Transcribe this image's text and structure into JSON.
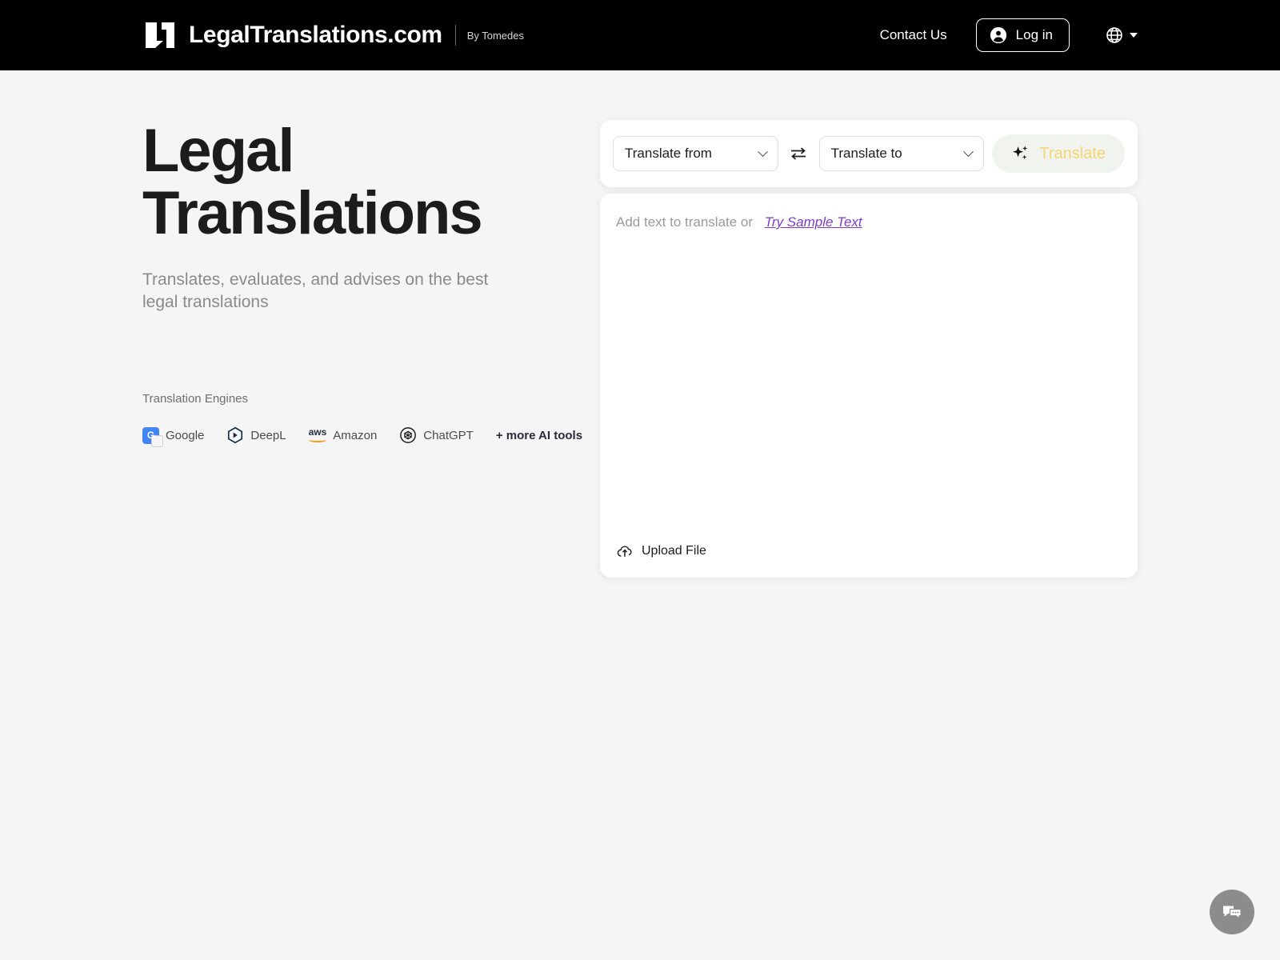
{
  "header": {
    "brand_name": "LegalTranslations.com",
    "brand_by": "By Tomedes",
    "contact_label": "Contact Us",
    "login_label": "Log in",
    "logo_icon": "legal-translations-logo",
    "account_icon": "account-circle-icon",
    "globe_icon": "globe-icon",
    "caret_icon": "chevron-down-icon",
    "background": "#000000"
  },
  "hero": {
    "headline_line1": "Legal",
    "headline_line2": "Translations",
    "subtitle": "Translates, evaluates, and advises on the best legal translations",
    "engines_label": "Translation Engines",
    "engines": [
      {
        "name": "Google",
        "icon": "google-translate-icon",
        "glyph": "G"
      },
      {
        "name": "DeepL",
        "icon": "deepl-icon"
      },
      {
        "name": "Amazon",
        "icon": "aws-icon",
        "glyph": "aws"
      },
      {
        "name": "ChatGPT",
        "icon": "openai-icon"
      }
    ],
    "more_tools_label": "+ more AI tools"
  },
  "translator": {
    "source_select": {
      "value": "Translate from",
      "chevron_icon": "chevron-down-icon"
    },
    "swap_icon": "swap-horizontal-icon",
    "target_select": {
      "value": "Translate to",
      "chevron_icon": "chevron-down-icon"
    },
    "translate_button": {
      "label": "Translate",
      "icon": "sparkles-icon",
      "text_color": "#f5d472",
      "background": "#f1f3ee"
    },
    "editor": {
      "prompt": "Add text to translate or",
      "sample_link": "Try Sample Text",
      "sample_link_color": "#7d3cc4",
      "upload_label": "Upload File",
      "upload_icon": "cloud-upload-icon"
    }
  },
  "chat_widget": {
    "icon": "chat-bubbles-icon",
    "background": "#8c8c8c"
  },
  "theme": {
    "page_background": "#f5f5f5",
    "card_background": "#ffffff",
    "heading_color": "#1c1c1c",
    "muted_text": "#8a8a8a"
  }
}
